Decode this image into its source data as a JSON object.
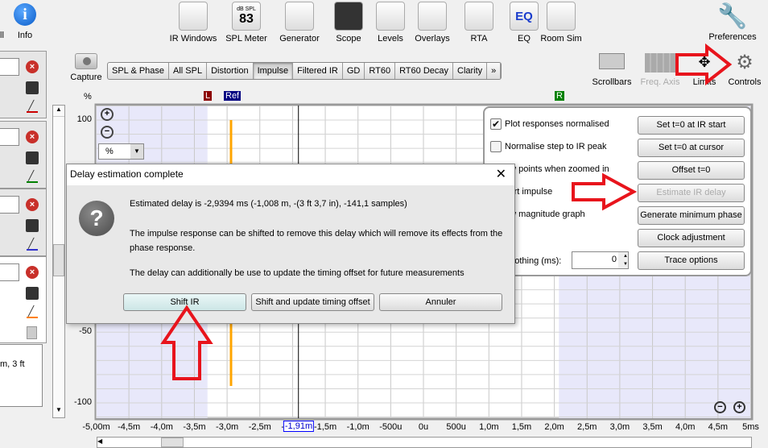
{
  "toolbar": {
    "left": [
      {
        "label": "ll",
        "icon": "all-icon"
      },
      {
        "label": "Info",
        "icon": "info-icon"
      }
    ],
    "tools": [
      {
        "label": "IR Windows",
        "icon": "ir-windows-icon"
      },
      {
        "label": "SPL Meter",
        "icon": "spl-meter-icon",
        "top": "dB SPL",
        "value": "83"
      },
      {
        "label": "Generator",
        "icon": "generator-icon"
      },
      {
        "label": "Scope",
        "icon": "scope-icon"
      },
      {
        "label": "Levels",
        "icon": "levels-icon"
      },
      {
        "label": "Overlays",
        "icon": "overlays-icon"
      },
      {
        "label": "RTA",
        "icon": "rta-icon"
      },
      {
        "label": "EQ",
        "icon": "eq-icon"
      },
      {
        "label": "Room Sim",
        "icon": "room-sim-icon"
      }
    ],
    "preferences": "Preferences"
  },
  "capture": "Capture",
  "tabs": [
    "SPL & Phase",
    "All SPL",
    "Distortion",
    "Impulse",
    "Filtered IR",
    "GD",
    "RT60",
    "RT60 Decay",
    "Clarity",
    "»"
  ],
  "active_tab": "Impulse",
  "view_controls": {
    "scrollbars": "Scrollbars",
    "freq_axis": "Freq. Axis",
    "limits": "Limits",
    "controls": "Controls"
  },
  "measurements": [
    {
      "color": "#cc0000"
    },
    {
      "color": "#008000"
    },
    {
      "color": "#3333cc"
    },
    {
      "color": "#ff8000"
    }
  ],
  "notes_text": "m, 3 ft",
  "plot": {
    "y_unit": "%",
    "unit_select": "%",
    "markers": {
      "left": "L",
      "ref": "Ref",
      "right": "R"
    },
    "cursor_label": "-1,91m",
    "y_ticks": [
      "100",
      "-50",
      "-100"
    ],
    "x_ticks": [
      "-5,00m",
      "-4,5m",
      "-4,0m",
      "-3,5m",
      "-3,0m",
      "-2,5m",
      "-2,0m",
      "-1,5m",
      "-1,0m",
      "-500u",
      "0u",
      "500u",
      "1,0m",
      "1,5m",
      "2,0m",
      "2,5m",
      "3,0m",
      "3,5m",
      "4,0m",
      "4,5m",
      "5ms"
    ],
    "trace_color": "#ffa500",
    "window_color": "#e8e8fa"
  },
  "controls_panel": {
    "checks": [
      {
        "label": "Plot responses normalised",
        "checked": true
      },
      {
        "label": "Normalise step to IR peak",
        "checked": false
      },
      {
        "label": "ow points when zoomed in",
        "checked": false
      },
      {
        "label": "vert impulse",
        "checked": false
      },
      {
        "label": "ow magnitude graph",
        "checked": false
      }
    ],
    "smoothing_label": "noothing (ms):",
    "smoothing_value": "0",
    "buttons": [
      "Set t=0 at IR start",
      "Set t=0 at cursor",
      "Offset t=0",
      "Estimate IR delay",
      "Generate minimum phase",
      "Clock adjustment",
      "Trace options"
    ]
  },
  "dialog": {
    "title": "Delay estimation complete",
    "line1": "Estimated delay is -2,9394 ms (-1,008 m, -(3 ft 3,7 in), -141,1 samples)",
    "line2": "The impulse response can be shifted to remove this delay which will remove its effects from the phase response.",
    "line3": "The delay can additionally be use to update the timing offset for future measurements",
    "buttons": [
      "Shift IR",
      "Shift and update timing offset",
      "Annuler"
    ]
  },
  "annotation_color": "#e8141c"
}
